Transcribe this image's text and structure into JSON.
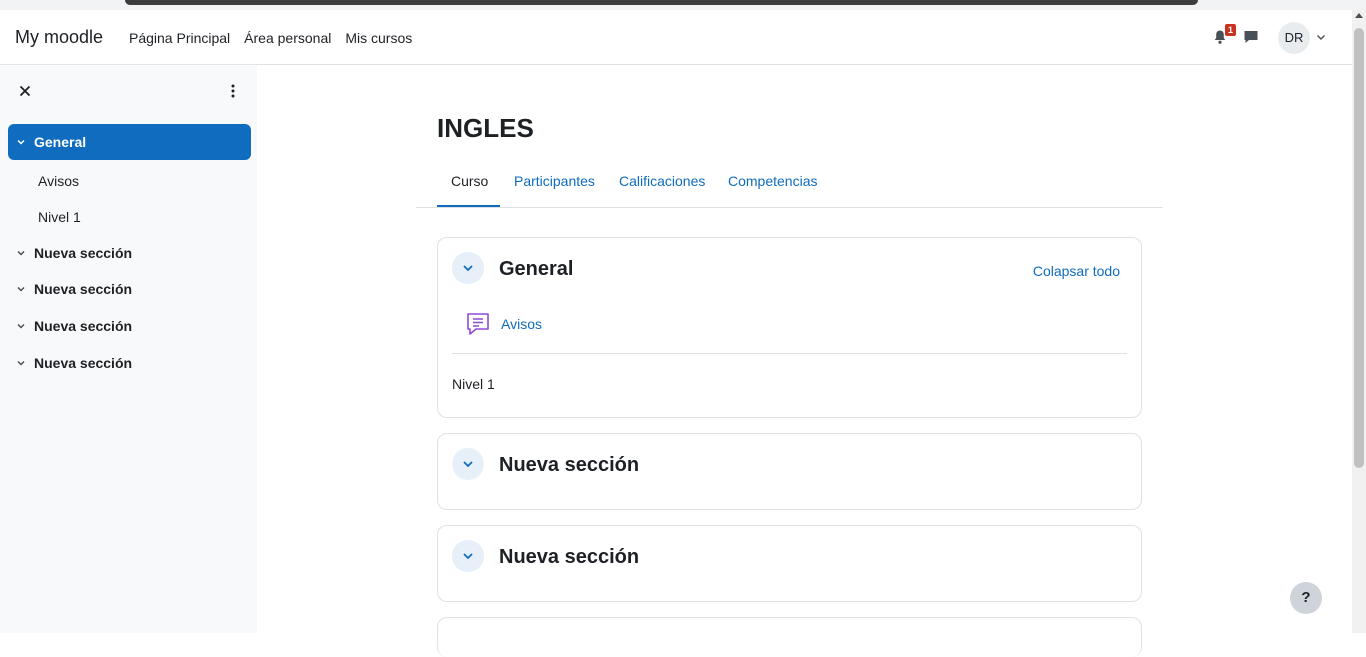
{
  "navbar": {
    "brand": "My moodle",
    "links": [
      "Página Principal",
      "Área personal",
      "Mis cursos"
    ],
    "notification_count": "1",
    "avatar_initials": "DR"
  },
  "drawer": {
    "sections": [
      {
        "label": "General",
        "active": true,
        "items": [
          "Avisos",
          "Nivel 1"
        ]
      },
      {
        "label": "Nueva sección"
      },
      {
        "label": "Nueva sección"
      },
      {
        "label": "Nueva sección"
      },
      {
        "label": "Nueva sección"
      }
    ]
  },
  "course": {
    "title": "INGLES",
    "tabs": [
      "Curso",
      "Participantes",
      "Calificaciones",
      "Competencias"
    ]
  },
  "sections": [
    {
      "title": "General",
      "collapse_all": "Colapsar todo",
      "activity": "Avisos",
      "label_text": "Nivel 1"
    },
    {
      "title": "Nueva sección"
    },
    {
      "title": "Nueva sección"
    }
  ],
  "help": "?",
  "colors": {
    "accent": "#0f6cbf",
    "badge": "#ca3120",
    "forum_icon": "#8f4ad8"
  }
}
